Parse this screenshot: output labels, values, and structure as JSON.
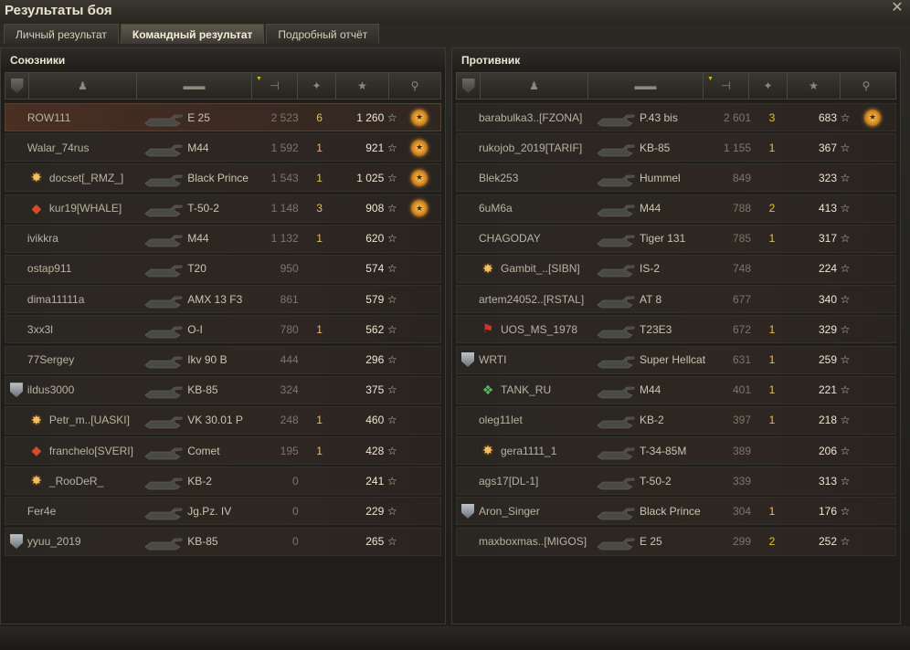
{
  "window": {
    "title": "Результаты боя",
    "close_label": "✕"
  },
  "tabs": [
    {
      "label": "Личный результат",
      "active": false
    },
    {
      "label": "Командный результат",
      "active": true
    },
    {
      "label": "Подробный отчёт",
      "active": false
    }
  ],
  "columns": {
    "squad": "squad-icon",
    "player": "player-icon",
    "tank": "tank-icon",
    "damage": "damage-icon",
    "kills": "kills-icon",
    "xp": "star-icon",
    "medal": "medal-icon"
  },
  "allies": {
    "title": "Союзники",
    "rows": [
      {
        "squad": "",
        "badge": "",
        "name": "ROW111",
        "tank": "E 25",
        "damage": "2 523",
        "kills": "6",
        "xp": "1 260",
        "medal": true,
        "me": true
      },
      {
        "squad": "",
        "badge": "",
        "name": "Walar_74rus",
        "tank": "M44",
        "damage": "1 592",
        "kills": "1",
        "xp": "921",
        "medal": true
      },
      {
        "squad": "",
        "badge": "star",
        "name": "docset[_RMZ_]",
        "tank": "Black Prince",
        "damage": "1 543",
        "kills": "1",
        "xp": "1 025",
        "medal": true
      },
      {
        "squad": "",
        "badge": "diamond",
        "name": "kur19[WHALE]",
        "tank": "T-50-2",
        "damage": "1 148",
        "kills": "3",
        "xp": "908",
        "medal": true
      },
      {
        "squad": "",
        "badge": "",
        "name": "ivikkra",
        "tank": "M44",
        "damage": "1 132",
        "kills": "1",
        "xp": "620",
        "medal": false
      },
      {
        "squad": "",
        "badge": "",
        "name": "ostap911",
        "tank": "T20",
        "damage": "950",
        "kills": "",
        "xp": "574",
        "medal": false
      },
      {
        "squad": "",
        "badge": "",
        "name": "dima11111a",
        "tank": "AMX 13 F3",
        "damage": "861",
        "kills": "",
        "xp": "579",
        "medal": false
      },
      {
        "squad": "",
        "badge": "",
        "name": "3xx3l",
        "tank": "O-I",
        "damage": "780",
        "kills": "1",
        "xp": "562",
        "medal": false
      },
      {
        "squad": "",
        "badge": "",
        "name": "77Sergey",
        "tank": "Ikv 90 B",
        "damage": "444",
        "kills": "",
        "xp": "296",
        "medal": false
      },
      {
        "squad": "shield",
        "badge": "",
        "name": "ildus3000",
        "tank": "KB-85",
        "damage": "324",
        "kills": "",
        "xp": "375",
        "medal": false
      },
      {
        "squad": "",
        "badge": "star",
        "name": "Petr_m..[UASKI]",
        "tank": "VK 30.01 P",
        "damage": "248",
        "kills": "1",
        "xp": "460",
        "medal": false
      },
      {
        "squad": "",
        "badge": "diamond",
        "name": "franchelo[SVERI]",
        "tank": "Comet",
        "damage": "195",
        "kills": "1",
        "xp": "428",
        "medal": false
      },
      {
        "squad": "",
        "badge": "star",
        "name": "_RooDeR_",
        "tank": "KB-2",
        "damage": "0",
        "kills": "",
        "xp": "241",
        "medal": false
      },
      {
        "squad": "",
        "badge": "",
        "name": "Fer4e",
        "tank": "Jg.Pz. IV",
        "damage": "0",
        "kills": "",
        "xp": "229",
        "medal": false
      },
      {
        "squad": "shield",
        "badge": "",
        "name": "yyuu_2019",
        "tank": "KB-85",
        "damage": "0",
        "kills": "",
        "xp": "265",
        "medal": false
      }
    ]
  },
  "enemies": {
    "title": "Противник",
    "rows": [
      {
        "squad": "",
        "badge": "",
        "name": "barabulka3..[FZONA]",
        "tank": "P.43 bis",
        "damage": "2 601",
        "kills": "3",
        "xp": "683",
        "medal": true
      },
      {
        "squad": "",
        "badge": "",
        "name": "rukojob_2019[TARIF]",
        "tank": "KB-85",
        "damage": "1 155",
        "kills": "1",
        "xp": "367",
        "medal": false
      },
      {
        "squad": "",
        "badge": "",
        "name": "Blek253",
        "tank": "Hummel",
        "damage": "849",
        "kills": "",
        "xp": "323",
        "medal": false
      },
      {
        "squad": "",
        "badge": "",
        "name": "6uM6a",
        "tank": "M44",
        "damage": "788",
        "kills": "2",
        "xp": "413",
        "medal": false
      },
      {
        "squad": "",
        "badge": "",
        "name": "CHAGODAY",
        "tank": "Tiger 131",
        "damage": "785",
        "kills": "1",
        "xp": "317",
        "medal": false
      },
      {
        "squad": "",
        "badge": "star",
        "name": "Gambit_..[SIBN]",
        "tank": "IS-2",
        "damage": "748",
        "kills": "",
        "xp": "224",
        "medal": false
      },
      {
        "squad": "",
        "badge": "",
        "name": "artem24052..[RSTAL]",
        "tank": "AT 8",
        "damage": "677",
        "kills": "",
        "xp": "340",
        "medal": false
      },
      {
        "squad": "",
        "badge": "flag",
        "name": "UOS_MS_1978",
        "tank": "T23E3",
        "damage": "672",
        "kills": "1",
        "xp": "329",
        "medal": false
      },
      {
        "squad": "shield",
        "badge": "",
        "name": "WRTI",
        "tank": "Super Hellcat",
        "damage": "631",
        "kills": "1",
        "xp": "259",
        "medal": false
      },
      {
        "squad": "",
        "badge": "gem",
        "name": "TANK_RU",
        "tank": "M44",
        "damage": "401",
        "kills": "1",
        "xp": "221",
        "medal": false
      },
      {
        "squad": "",
        "badge": "",
        "name": "oleg11let",
        "tank": "KB-2",
        "damage": "397",
        "kills": "1",
        "xp": "218",
        "medal": false
      },
      {
        "squad": "",
        "badge": "star",
        "name": "gera1111_1",
        "tank": "T-34-85M",
        "damage": "389",
        "kills": "",
        "xp": "206",
        "medal": false
      },
      {
        "squad": "",
        "badge": "",
        "name": "ags17[DL-1]",
        "tank": "T-50-2",
        "damage": "339",
        "kills": "",
        "xp": "313",
        "medal": false
      },
      {
        "squad": "shield",
        "badge": "",
        "name": "Aron_Singer",
        "tank": "Black Prince",
        "damage": "304",
        "kills": "1",
        "xp": "176",
        "medal": false
      },
      {
        "squad": "",
        "badge": "",
        "name": "maxboxmas..[MIGOS]",
        "tank": "E 25",
        "damage": "299",
        "kills": "2",
        "xp": "252",
        "medal": false
      }
    ]
  },
  "star_symbol": "☆",
  "medal_symbol": "★"
}
